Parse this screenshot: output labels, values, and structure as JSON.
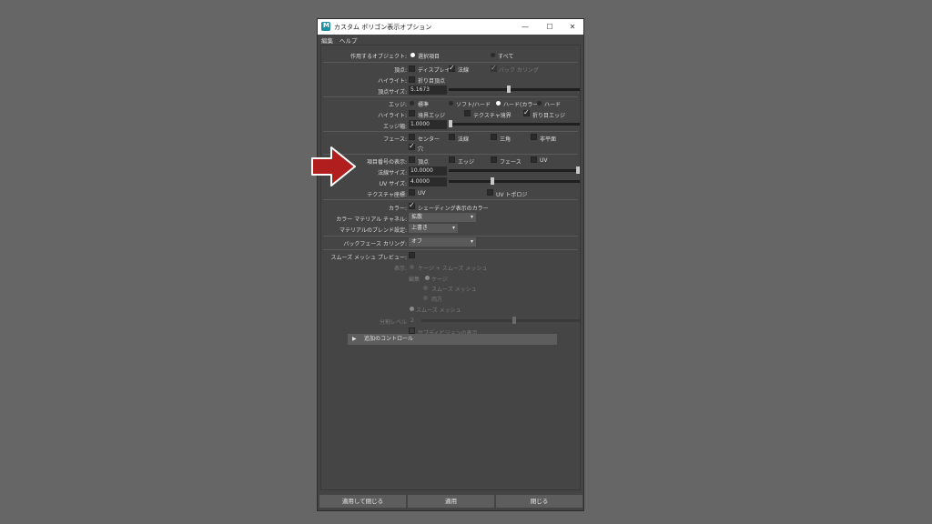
{
  "window": {
    "title": "カスタム ポリゴン表示オプション",
    "minimize": "—",
    "maximize": "☐",
    "close": "✕"
  },
  "menu": {
    "edit": "編集",
    "help": "ヘルプ"
  },
  "target": {
    "label": "作用するオブジェクト:",
    "selected": "選択項目",
    "all": "すべて"
  },
  "vertices": {
    "label": "頂点:",
    "display": "ディスプレイ",
    "normal": "法線",
    "backface": "バック カリング",
    "highlight_label": "ハイライト:",
    "fold": "折り目頂点",
    "size_label": "頂点サイズ:",
    "size_value": "5.1673"
  },
  "edges": {
    "label": "エッジ:",
    "standard": "標準",
    "soft_hard": "ソフト/ハード",
    "hard_color": "ハード(カラー",
    "hard": "ハード",
    "highlight_label": "ハイライト:",
    "border": "境界エッジ",
    "texture_border": "テクスチャ境界",
    "crease": "折り目エッジ",
    "width_label": "エッジ幅:",
    "width_value": "1.0000"
  },
  "faces": {
    "label": "フェース:",
    "center": "センター",
    "normal": "法線",
    "triangle": "三角",
    "nonplanar": "非平面",
    "hole": "穴"
  },
  "numbering": {
    "label": "項目番号の表示:",
    "vertex": "頂点",
    "edge": "エッジ",
    "face": "フェース",
    "uv": "UV",
    "normal_size_label": "法線サイズ:",
    "normal_size_value": "10.0000",
    "uv_size_label": "UV サイズ:",
    "uv_size_value": "4.0000",
    "texcoord_label": "テクスチャ座標:",
    "uv_item": "UV",
    "uv_topology": "UV トポロジ"
  },
  "color": {
    "label": "カラー:",
    "shaded": "シェーディング表示のカラー",
    "channel_label": "カラー マテリアル チャネル:",
    "channel_value": "拡散",
    "blend_label": "マテリアルのブレンド設定:",
    "blend_value": "上書き"
  },
  "culling": {
    "label": "バックフェース カリング:",
    "value": "オフ"
  },
  "smooth": {
    "preview_label": "スムーズ メッシュ プレビュー:",
    "display_label": "表示:",
    "cage_plus": "ケージ + スムーズ メッシュ",
    "edit_label": "編集",
    "cage": "ケージ",
    "smooth_mesh": "スムーズ メッシュ",
    "both": "両方",
    "smooth_mesh2": "スムーズ メッシュ",
    "division_label": "分割レベル",
    "division_value": "2",
    "subdiv_display": "サブディビジョンの表示"
  },
  "extra": {
    "label": "追加のコントロール"
  },
  "buttons": {
    "apply_close": "適用して閉じる",
    "apply": "適用",
    "close": "閉じる"
  },
  "colors": {
    "accent_arrow": "#b01e1e",
    "panel": "#454545",
    "background": "#666666"
  }
}
